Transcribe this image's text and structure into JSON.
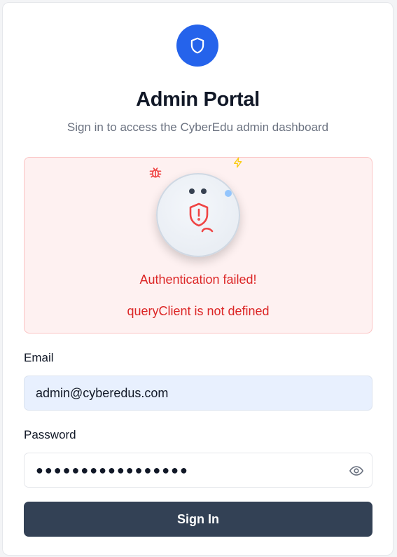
{
  "header": {
    "title": "Admin Portal",
    "subtitle": "Sign in to access the CyberEdu admin dashboard",
    "logo_icon": "shield-icon"
  },
  "alert": {
    "title": "Authentication failed!",
    "message": "queryClient is not defined",
    "icons": [
      "bug-icon",
      "bolt-icon",
      "shield-alert-icon"
    ]
  },
  "form": {
    "email_label": "Email",
    "email_value": "admin@cyberedus.com",
    "password_label": "Password",
    "password_value": "●●●●●●●●●●●●●●●●●",
    "show_password_icon": "eye-icon",
    "submit_label": "Sign In"
  },
  "colors": {
    "accent": "#2563eb",
    "error": "#dc2626",
    "alert_bg": "#fef1f1",
    "button_bg": "#334155",
    "input_autofill_bg": "#e8f0fe"
  }
}
